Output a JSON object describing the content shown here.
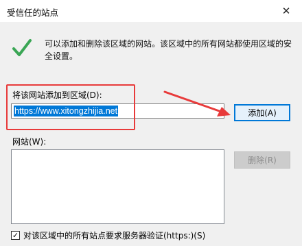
{
  "window": {
    "title": "受信任的站点",
    "close_label": "✕"
  },
  "info": {
    "icon": "check-icon",
    "line1": "可以添加和删除该区域的网站。该区域中的所有网站都使用区域的安",
    "line2": "全设置。"
  },
  "add_site": {
    "label": "将该网站添加到区域(D):",
    "value": "https://www.xitongzhijia.net",
    "add_button": "添加(A)"
  },
  "sites": {
    "label": "网站(W):",
    "items": [],
    "remove_button": "删除(R)"
  },
  "https_check": {
    "checked": true,
    "mark": "✓",
    "label": "对该区域中的所有站点要求服务器验证(https:)(S)"
  },
  "colors": {
    "accent": "#0078d7",
    "annotation_red": "#e83a3a",
    "check_green": "#3aa655"
  }
}
